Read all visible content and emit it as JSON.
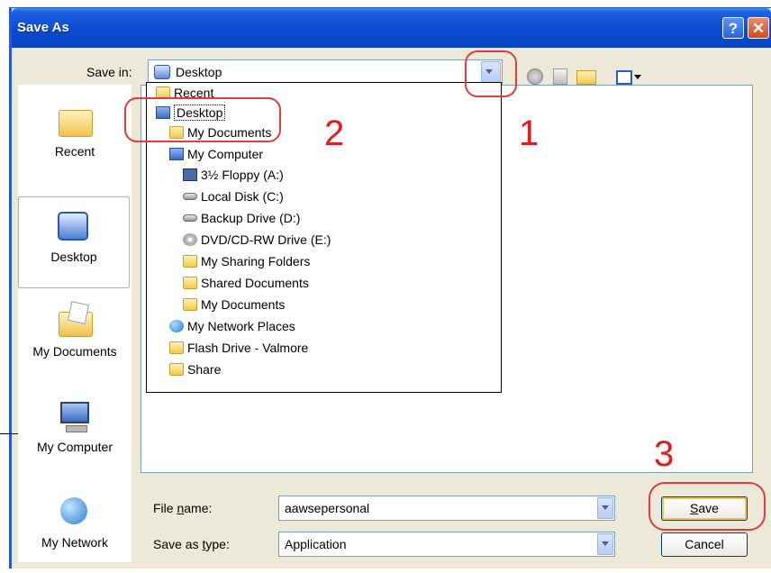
{
  "window": {
    "title": "Save As",
    "help_glyph": "?",
    "close_glyph": "✕"
  },
  "save_in": {
    "label": "Save in:",
    "value": "Desktop"
  },
  "places": [
    {
      "label": "Recent",
      "icon": "recent-folder-icon"
    },
    {
      "label": "Desktop",
      "icon": "desktop-icon",
      "selected": true
    },
    {
      "label": "My Documents",
      "icon": "my-documents-icon"
    },
    {
      "label": "My Computer",
      "icon": "my-computer-icon"
    },
    {
      "label": "My Network",
      "icon": "my-network-icon"
    }
  ],
  "dropdown_items": [
    {
      "label": "Recent",
      "icon": "folder"
    },
    {
      "label": "Desktop",
      "icon": "desktop",
      "selected": true
    },
    {
      "label": "My Documents",
      "icon": "folder"
    },
    {
      "label": "My Computer",
      "icon": "computer"
    },
    {
      "label": "3½ Floppy (A:)",
      "icon": "floppy"
    },
    {
      "label": "Local Disk (C:)",
      "icon": "drive"
    },
    {
      "label": "Backup Drive (D:)",
      "icon": "drive"
    },
    {
      "label": "DVD/CD-RW Drive (E:)",
      "icon": "disc"
    },
    {
      "label": "My Sharing Folders",
      "icon": "folder"
    },
    {
      "label": "Shared Documents",
      "icon": "folder"
    },
    {
      "label": "My Documents",
      "icon": "folder"
    },
    {
      "label": "My Network Places",
      "icon": "globe"
    },
    {
      "label": "Flash Drive - Valmore",
      "icon": "folder"
    },
    {
      "label": "Share",
      "icon": "folder"
    }
  ],
  "file_name": {
    "label_pre": "File ",
    "label_u": "n",
    "label_post": "ame:",
    "value": "aawsepersonal"
  },
  "save_as_type": {
    "label_pre": "Save as ",
    "label_u": "t",
    "label_post": "ype:",
    "value": "Application"
  },
  "buttons": {
    "save_u": "S",
    "save_rest": "ave",
    "cancel": "Cancel"
  },
  "annotations": {
    "step1": "1",
    "step2": "2",
    "step3": "3"
  },
  "colors": {
    "annotation": "#E21B1B",
    "titlebar": "#0A4BD4"
  }
}
